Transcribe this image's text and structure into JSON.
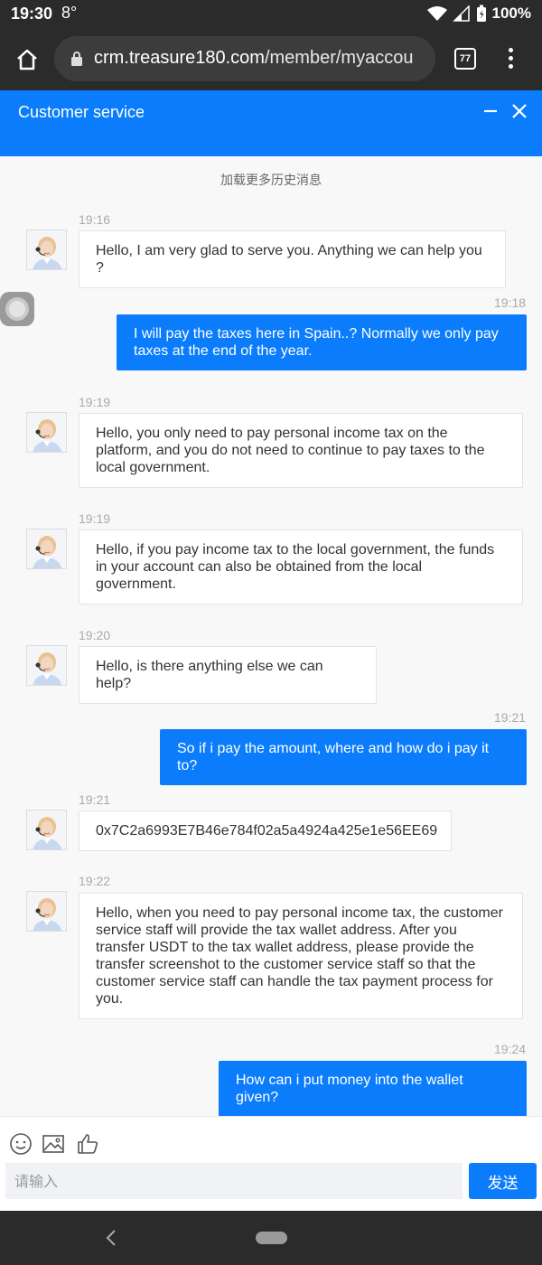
{
  "status_bar": {
    "time": "19:30",
    "temp": "8°",
    "battery": "100%"
  },
  "browser": {
    "url_domain": "crm.treasure180.com",
    "url_path": "/member/myaccou",
    "tab_count": "77"
  },
  "header": {
    "title": "Customer service"
  },
  "chat": {
    "load_more": "加载更多历史消息",
    "messages": [
      {
        "from": "agent",
        "time": "19:16",
        "text": "Hello, I am very glad to serve you. Anything we can help you ?"
      },
      {
        "from": "user",
        "time": "19:18",
        "text": "I will pay the taxes here in Spain..? Normally we only pay taxes at the end of the year."
      },
      {
        "from": "agent",
        "time": "19:19",
        "text": "Hello, you only need to pay personal income tax on the platform, and you do not need to continue to pay taxes to the local government."
      },
      {
        "from": "agent",
        "time": "19:19",
        "text": "Hello, if you pay income tax to the local government, the funds in your account can also be obtained from the local government."
      },
      {
        "from": "agent",
        "time": "19:20",
        "text": "Hello, is there anything else we can help?"
      },
      {
        "from": "user",
        "time": "19:21",
        "text": "So if i pay the amount, where and how do i pay it to?"
      },
      {
        "from": "agent",
        "time": "19:21",
        "text": "0x7C2a6993E7B46e784f02a5a4924a425e1e56EE69"
      },
      {
        "from": "agent",
        "time": "19:22",
        "text": "Hello, when you need to pay personal income tax, the customer service staff will provide the tax wallet address. After you transfer USDT to the tax wallet address, please provide the transfer screenshot to the customer service staff so that the customer service staff can handle the tax payment process for you."
      },
      {
        "from": "user",
        "time": "19:24",
        "text": "How can i put money into the wallet given?"
      }
    ]
  },
  "composer": {
    "placeholder": "请输入",
    "send_label": "发送",
    "icons": [
      "emoji-icon",
      "image-icon",
      "thumbs-up-icon"
    ]
  },
  "colors": {
    "accent": "#0b7dfc",
    "chrome": "#2b2b2b"
  }
}
